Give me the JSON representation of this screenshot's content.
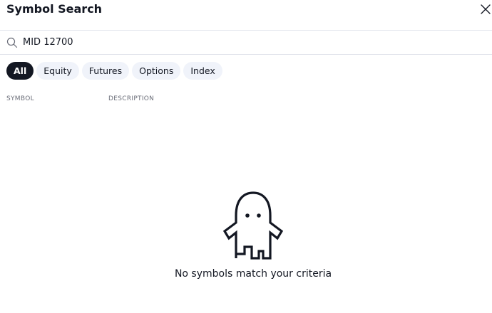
{
  "dialog": {
    "title": "Symbol Search"
  },
  "search": {
    "value": "MID 12700",
    "placeholder": "Search"
  },
  "filters": [
    {
      "label": "All",
      "active": true
    },
    {
      "label": "Equity",
      "active": false
    },
    {
      "label": "Futures",
      "active": false
    },
    {
      "label": "Options",
      "active": false
    },
    {
      "label": "Index",
      "active": false
    }
  ],
  "columns": {
    "symbol": "SYMBOL",
    "description": "DESCRIPTION"
  },
  "empty_state": {
    "message": "No symbols match your criteria",
    "illustration": "ghost-icon"
  },
  "icons": {
    "search": "search-icon",
    "close": "close-icon"
  },
  "colors": {
    "text": "#131722",
    "chip_bg": "#f0f3fa",
    "chip_active_bg": "#131722",
    "divider": "#e0e3eb",
    "muted": "#6a6d78"
  }
}
